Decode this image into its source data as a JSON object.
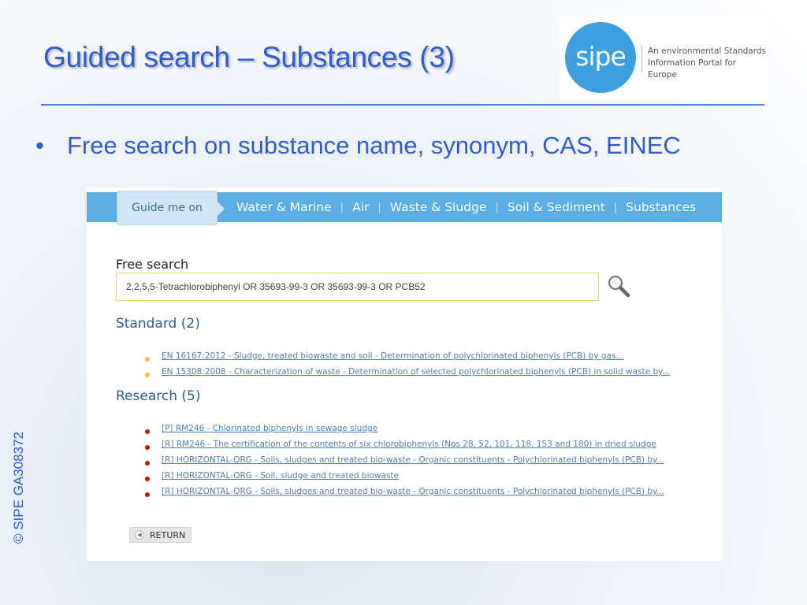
{
  "slide": {
    "title": "Guided search – Substances (3)",
    "bullet_symbol": "•",
    "bullet": "Free search on substance name, synonym, CAS, EINEC",
    "copyright": "© SIPE GA308372",
    "logo": {
      "word": "sipe",
      "tagline_line1": "An environmental Standards",
      "tagline_line2": "Information Portal for Europe"
    }
  },
  "app": {
    "nav": {
      "guide_tab": "Guide me on",
      "items": [
        "Water & Marine",
        "Air",
        "Waste & Sludge",
        "Soil & Sediment",
        "Substances"
      ]
    },
    "search": {
      "label": "Free search",
      "value": "2,2,5,5-Tetrachlorobiphenyl OR 35693-99-3 OR 35693-99-3 OR PCB52"
    },
    "standard": {
      "heading": "Standard (2)",
      "items": [
        "EN 16167:2012 - Sludge, treated biowaste and soil - Determination of polychlorinated biphenyls (PCB) by gas...",
        "EN 15308:2008 - Characterization of waste - Determination of selected polychlorinated biphenyls (PCB) in solid waste by..."
      ]
    },
    "research": {
      "heading": "Research (5)",
      "items": [
        "[P] RM246 - Chlorinated biphenyls in sewage sludge",
        "[R] RM246 - The certification of the contents of six chlorobiphenyls (Nos 28, 52, 101, 118, 153 and 180) in dried sludge",
        "[R] HORIZONTAL-ORG - Soils, sludges and treated bio-waste - Organic constituents - Polychlorinated biphenyls (PCB) by...",
        "[R] HORIZONTAL-ORG - Soil, sludge and treated biowaste",
        "[R] HORIZONTAL-ORG - Soils, sludges and treated bio-waste - Organic constituents - Polychlorinated biphenyls (PCB) by..."
      ]
    },
    "return_label": "RETURN"
  },
  "colors": {
    "title_blue": "#2d5dd1",
    "nav_blue": "#5aaee3",
    "standard_dot": "#f0c040",
    "research_dot": "#cc1111",
    "link_blue": "#4e7fb3"
  },
  "icons": {
    "search": "magnifier-icon",
    "return": "back-arrow-icon"
  }
}
